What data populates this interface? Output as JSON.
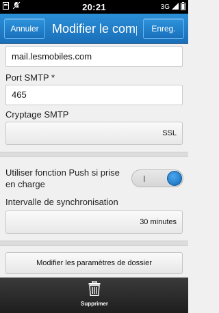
{
  "status_bar": {
    "time": "20:21",
    "network": "3G",
    "icons": [
      "notification-icon",
      "silent-bell-icon",
      "signal-icon",
      "battery-icon"
    ]
  },
  "header": {
    "cancel_label": "Annuler",
    "title": "Modifier le comp",
    "save_label": "Enreg."
  },
  "form": {
    "server_value": "mail.lesmobiles.com",
    "smtp_port_label": "Port SMTP *",
    "smtp_port_value": "465",
    "encryption_label": "Cryptage SMTP",
    "encryption_value": "SSL",
    "push_label_line1": "Utiliser fonction Push si prise",
    "push_label_line2": "en charge",
    "push_enabled": true,
    "push_toggle_mark": "I",
    "sync_interval_label": "Intervalle de synchronisation",
    "sync_interval_value": "30 minutes",
    "folder_settings_label": "Modifier les paramètres de dossier"
  },
  "bottom_bar": {
    "delete_label": "Supprimer",
    "delete_icon": "trash-icon"
  },
  "colors": {
    "header_blue": "#1a6fb9",
    "toggle_knob": "#1f7cd0",
    "bottom_bar": "#2a2a2a"
  }
}
